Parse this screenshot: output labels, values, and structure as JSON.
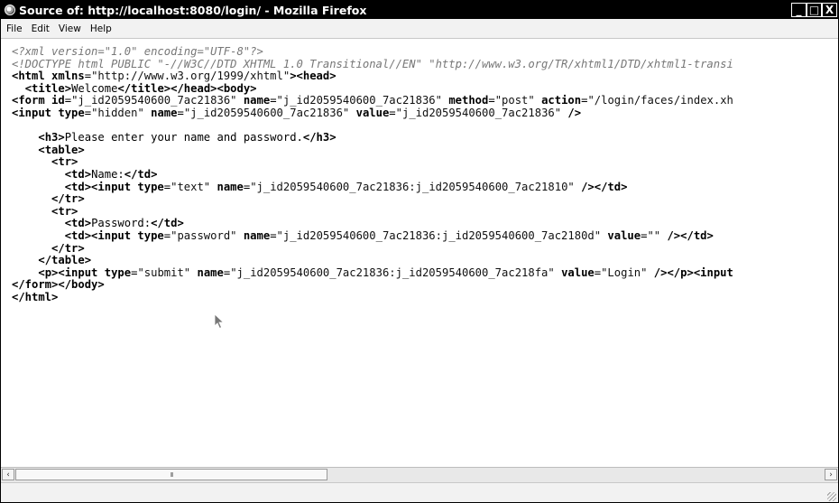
{
  "window": {
    "title": "Source of: http://localhost:8080/login/ - Mozilla Firefox",
    "controls": {
      "minimize": "_",
      "maximize": "□",
      "close": "X"
    }
  },
  "menu": [
    {
      "label": "File"
    },
    {
      "label": "Edit"
    },
    {
      "label": "View"
    },
    {
      "label": "Help"
    }
  ],
  "source_lines": [
    [
      {
        "t": "pi",
        "s": "<?xml version=\"1.0\" encoding=\"UTF-8\"?>"
      }
    ],
    [
      {
        "t": "pi",
        "s": "<!DOCTYPE html PUBLIC \"-//W3C//DTD XHTML 1.0 Transitional//EN\" \"http://www.w3.org/TR/xhtml1/DTD/xhtml1-transi"
      }
    ],
    [
      {
        "t": "tag",
        "s": "<html "
      },
      {
        "t": "attr",
        "s": "xmlns"
      },
      {
        "t": "txt",
        "s": "="
      },
      {
        "t": "val",
        "s": "\"http://www.w3.org/1999/xhtml\""
      },
      {
        "t": "tag",
        "s": "><head>"
      }
    ],
    [
      {
        "t": "txt",
        "s": "  "
      },
      {
        "t": "tag",
        "s": "<title>"
      },
      {
        "t": "txt",
        "s": "Welcome"
      },
      {
        "t": "tag",
        "s": "</title></head><body>"
      }
    ],
    [
      {
        "t": "tag",
        "s": "<form "
      },
      {
        "t": "attr",
        "s": "id"
      },
      {
        "t": "txt",
        "s": "="
      },
      {
        "t": "val",
        "s": "\"j_id2059540600_7ac21836\" "
      },
      {
        "t": "attr",
        "s": "name"
      },
      {
        "t": "txt",
        "s": "="
      },
      {
        "t": "val",
        "s": "\"j_id2059540600_7ac21836\" "
      },
      {
        "t": "attr",
        "s": "method"
      },
      {
        "t": "txt",
        "s": "="
      },
      {
        "t": "val",
        "s": "\"post\" "
      },
      {
        "t": "attr",
        "s": "action"
      },
      {
        "t": "txt",
        "s": "="
      },
      {
        "t": "val",
        "s": "\"/login/faces/index.xh"
      }
    ],
    [
      {
        "t": "tag",
        "s": "<input "
      },
      {
        "t": "attr",
        "s": "type"
      },
      {
        "t": "txt",
        "s": "="
      },
      {
        "t": "val",
        "s": "\"hidden\" "
      },
      {
        "t": "attr",
        "s": "name"
      },
      {
        "t": "txt",
        "s": "="
      },
      {
        "t": "val",
        "s": "\"j_id2059540600_7ac21836\" "
      },
      {
        "t": "attr",
        "s": "value"
      },
      {
        "t": "txt",
        "s": "="
      },
      {
        "t": "val",
        "s": "\"j_id2059540600_7ac21836\" "
      },
      {
        "t": "tag",
        "s": "/>"
      }
    ],
    [
      {
        "t": "txt",
        "s": ""
      }
    ],
    [
      {
        "t": "txt",
        "s": "    "
      },
      {
        "t": "tag",
        "s": "<h3>"
      },
      {
        "t": "txt",
        "s": "Please enter your name and password."
      },
      {
        "t": "tag",
        "s": "</h3>"
      }
    ],
    [
      {
        "t": "txt",
        "s": "    "
      },
      {
        "t": "tag",
        "s": "<table>"
      }
    ],
    [
      {
        "t": "txt",
        "s": "      "
      },
      {
        "t": "tag",
        "s": "<tr>"
      }
    ],
    [
      {
        "t": "txt",
        "s": "        "
      },
      {
        "t": "tag",
        "s": "<td>"
      },
      {
        "t": "txt",
        "s": "Name:"
      },
      {
        "t": "tag",
        "s": "</td>"
      }
    ],
    [
      {
        "t": "txt",
        "s": "        "
      },
      {
        "t": "tag",
        "s": "<td><input "
      },
      {
        "t": "attr",
        "s": "type"
      },
      {
        "t": "txt",
        "s": "="
      },
      {
        "t": "val",
        "s": "\"text\" "
      },
      {
        "t": "attr",
        "s": "name"
      },
      {
        "t": "txt",
        "s": "="
      },
      {
        "t": "val",
        "s": "\"j_id2059540600_7ac21836:j_id2059540600_7ac21810\" "
      },
      {
        "t": "tag",
        "s": "/></td>"
      }
    ],
    [
      {
        "t": "txt",
        "s": "      "
      },
      {
        "t": "tag",
        "s": "</tr>"
      }
    ],
    [
      {
        "t": "txt",
        "s": "      "
      },
      {
        "t": "tag",
        "s": "<tr>"
      }
    ],
    [
      {
        "t": "txt",
        "s": "        "
      },
      {
        "t": "tag",
        "s": "<td>"
      },
      {
        "t": "txt",
        "s": "Password:"
      },
      {
        "t": "tag",
        "s": "</td>"
      }
    ],
    [
      {
        "t": "txt",
        "s": "        "
      },
      {
        "t": "tag",
        "s": "<td><input "
      },
      {
        "t": "attr",
        "s": "type"
      },
      {
        "t": "txt",
        "s": "="
      },
      {
        "t": "val",
        "s": "\"password\" "
      },
      {
        "t": "attr",
        "s": "name"
      },
      {
        "t": "txt",
        "s": "="
      },
      {
        "t": "val",
        "s": "\"j_id2059540600_7ac21836:j_id2059540600_7ac2180d\" "
      },
      {
        "t": "attr",
        "s": "value"
      },
      {
        "t": "txt",
        "s": "="
      },
      {
        "t": "val",
        "s": "\"\" "
      },
      {
        "t": "tag",
        "s": "/></td>"
      }
    ],
    [
      {
        "t": "txt",
        "s": "      "
      },
      {
        "t": "tag",
        "s": "</tr>"
      }
    ],
    [
      {
        "t": "txt",
        "s": "    "
      },
      {
        "t": "tag",
        "s": "</table>"
      }
    ],
    [
      {
        "t": "txt",
        "s": "    "
      },
      {
        "t": "tag",
        "s": "<p><input "
      },
      {
        "t": "attr",
        "s": "type"
      },
      {
        "t": "txt",
        "s": "="
      },
      {
        "t": "val",
        "s": "\"submit\" "
      },
      {
        "t": "attr",
        "s": "name"
      },
      {
        "t": "txt",
        "s": "="
      },
      {
        "t": "val",
        "s": "\"j_id2059540600_7ac21836:j_id2059540600_7ac218fa\" "
      },
      {
        "t": "attr",
        "s": "value"
      },
      {
        "t": "txt",
        "s": "="
      },
      {
        "t": "val",
        "s": "\"Login\" "
      },
      {
        "t": "tag",
        "s": "/></p><input"
      }
    ],
    [
      {
        "t": "tag",
        "s": "</form></body>"
      }
    ],
    [
      {
        "t": "tag",
        "s": "</html>"
      }
    ]
  ],
  "scrollbar": {
    "left_arrow": "‹",
    "right_arrow": "›",
    "thumb_grip": "III"
  },
  "colors": {
    "titlebar": "#000000",
    "menubar": "#f2f2f2",
    "comment": "#777777"
  }
}
